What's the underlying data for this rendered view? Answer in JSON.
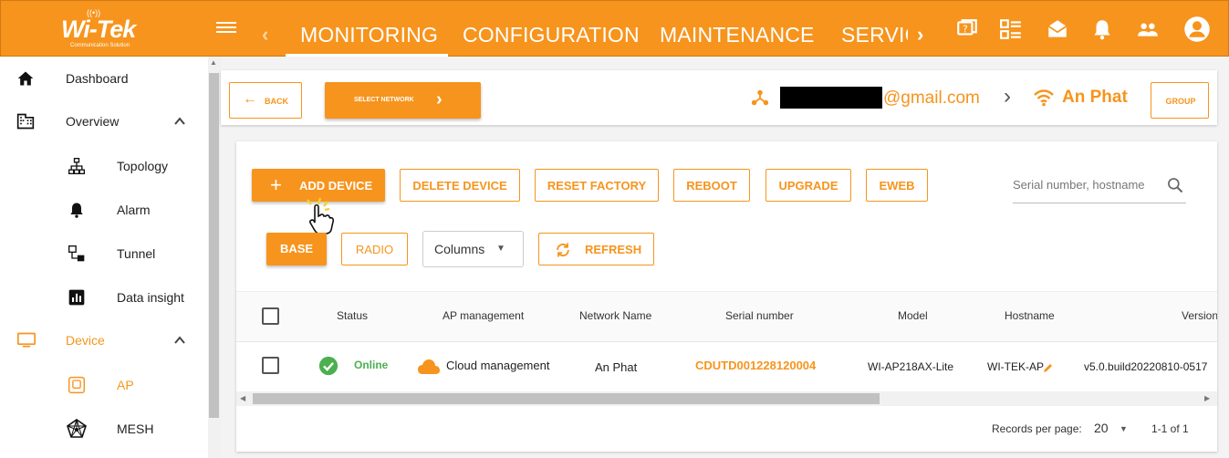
{
  "brand": {
    "logo_text": "Wi-Tek",
    "logo_sub": "Communication Solution"
  },
  "nav": {
    "tabs": [
      "MONITORING",
      "CONFIGURATION",
      "MAINTENANCE",
      "SERVICE"
    ],
    "icons": [
      "help-chat-icon",
      "dashboard-list-icon",
      "mail-icon",
      "bell-icon",
      "people-icon",
      "account-icon"
    ]
  },
  "sidebar": {
    "items": [
      {
        "label": "Dashboard"
      },
      {
        "label": "Overview"
      },
      {
        "label": "Topology"
      },
      {
        "label": "Alarm"
      },
      {
        "label": "Tunnel"
      },
      {
        "label": "Data insight"
      },
      {
        "label": "Device"
      },
      {
        "label": "AP"
      },
      {
        "label": "MESH"
      }
    ]
  },
  "header": {
    "back_label": "BACK",
    "select_network_label": "SELECT NETWORK",
    "email_suffix": "@gmail.com",
    "network_name": "An Phat",
    "group_label": "GROUP"
  },
  "toolbar": {
    "add_device": "ADD DEVICE",
    "delete_device": "DELETE DEVICE",
    "reset_factory": "RESET FACTORY",
    "reboot": "REBOOT",
    "upgrade": "UPGRADE",
    "eweb": "EWEB",
    "search_placeholder": "Serial number, hostname",
    "base": "BASE",
    "radio": "RADIO",
    "columns": "Columns",
    "refresh": "REFRESH"
  },
  "table": {
    "headers": [
      "Status",
      "AP management",
      "Network Name",
      "Serial number",
      "Model",
      "Hostname",
      "Version"
    ],
    "rows": [
      {
        "status": "Online",
        "management": "Cloud management",
        "network": "An Phat",
        "serial": "CDUTD001228120004",
        "model": "WI-AP218AX-Lite",
        "hostname": "WI-TEK-AP",
        "version": "v5.0.build20220810-0517"
      }
    ]
  },
  "pagination": {
    "records_label": "Records per page:",
    "per_page": "20",
    "range": "1-1 of 1"
  },
  "colors": {
    "accent": "#f7941d",
    "online": "#4caf50",
    "serial": "#f7941d"
  }
}
